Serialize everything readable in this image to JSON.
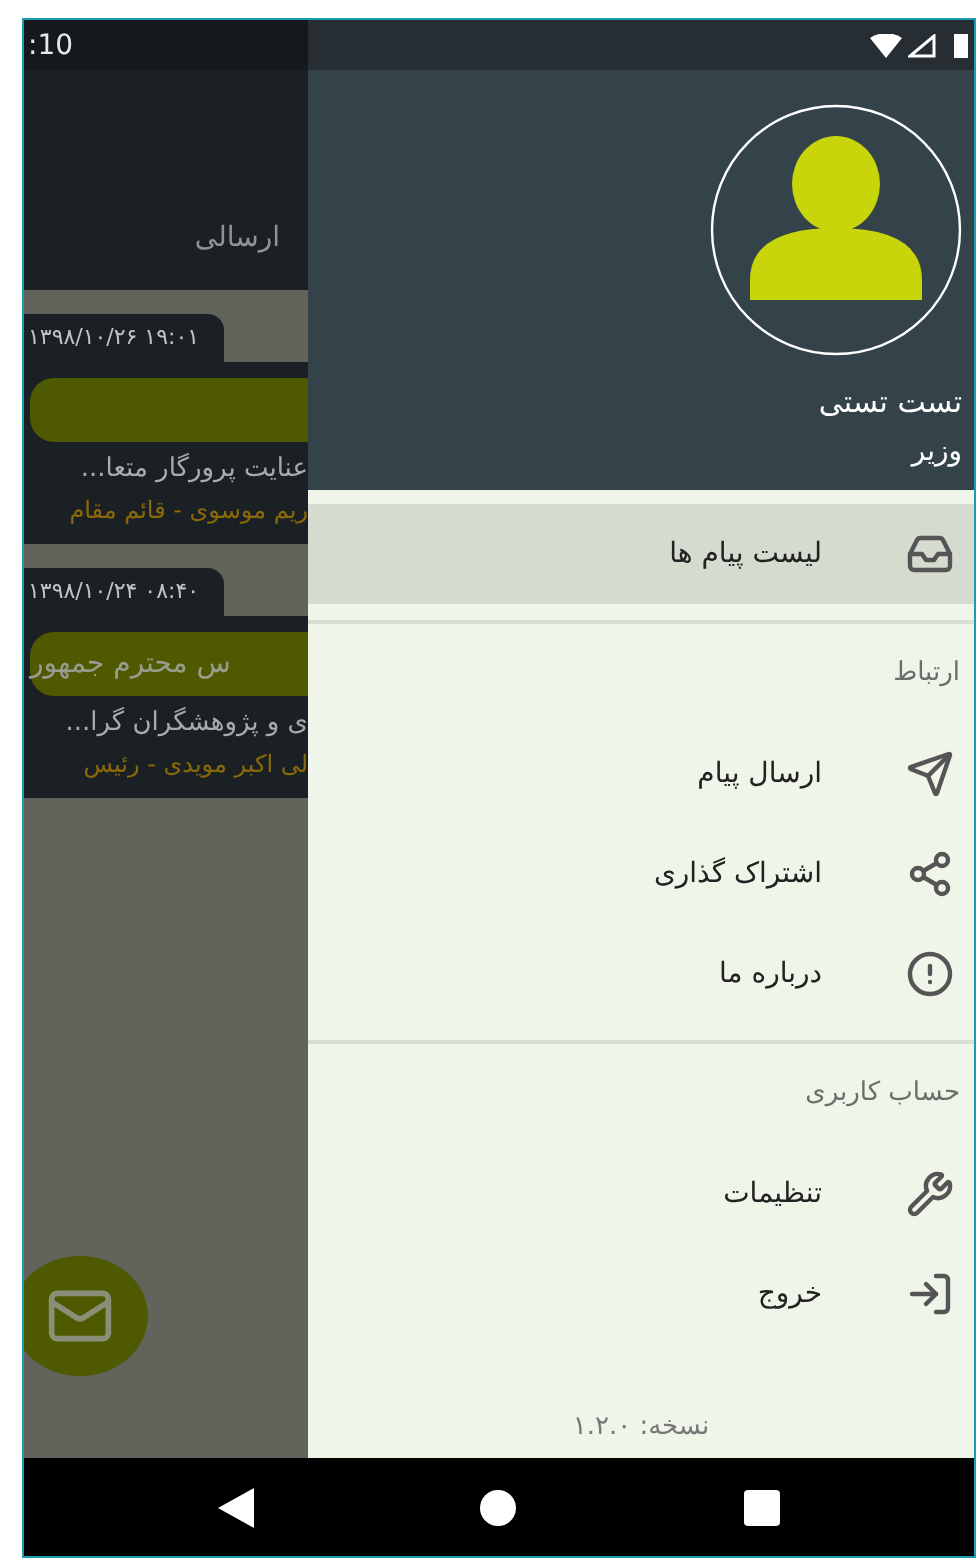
{
  "status_bar": {
    "time": ":10"
  },
  "background": {
    "tab": "ارسالی",
    "messages": [
      {
        "date": "۱۳۹۸/۱۰/۲۶ ۱۹:۰۱",
        "preview": "عنایت پرورگار متعا...",
        "sender": "ریم موسوی - قائم مقام"
      },
      {
        "date": "۱۳۹۸/۱۰/۲۴ ۰۸:۴۰",
        "subject": "س محترم جمهور",
        "preview": "ی و پژوهشگران گرا...",
        "sender": "لی اکبر مویدی - رئیس"
      }
    ]
  },
  "drawer": {
    "user": {
      "name": "تست تستی",
      "role": "وزیر"
    },
    "sections": [
      {
        "items": [
          {
            "label": "لیست پیام ها",
            "selected": true
          }
        ]
      },
      {
        "title": "ارتباط",
        "items": [
          {
            "label": "ارسال پیام",
            "selected": false
          },
          {
            "label": "اشتراک گذاری",
            "selected": false
          },
          {
            "label": "درباره ما",
            "selected": false
          }
        ]
      },
      {
        "title": "حساب کاربری",
        "items": [
          {
            "label": "تنظیمات",
            "selected": false
          },
          {
            "label": "خروج",
            "selected": false
          }
        ]
      }
    ],
    "version": "نسخه: ۱.۲.۰"
  }
}
